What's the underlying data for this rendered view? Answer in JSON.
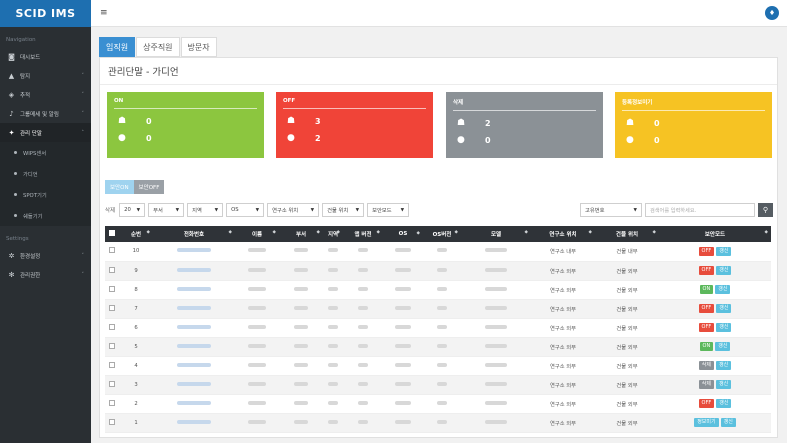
{
  "app": {
    "brand": "SCID IMS"
  },
  "colors": {
    "brand": "#1e6fb0",
    "on": "#8cc63f",
    "off": "#f04438",
    "delete": "#8b9196",
    "unreg": "#f6c323",
    "tab_active": "#3a8fd2",
    "toggle_on": "#9fd3ef",
    "toggle_off": "#9aa0a6",
    "badge_on": "#5cb85c",
    "badge_off": "#e74c3c",
    "badge_del": "#8b9196",
    "badge_unreg": "#5bc0de",
    "badge_info": "#5bc0de"
  },
  "sidebar": {
    "section1": "Navigation",
    "items": [
      {
        "label": "대시보드",
        "icon": "dashboard-icon",
        "glyph": "◙"
      },
      {
        "label": "탐지",
        "icon": "warning-icon",
        "glyph": "▲"
      },
      {
        "label": "추적",
        "icon": "tag-icon",
        "glyph": "◈"
      },
      {
        "label": "그룹메세 및 알림",
        "icon": "bell-icon",
        "glyph": "♪"
      },
      {
        "label": "관리 단말",
        "icon": "users-icon",
        "glyph": "✦"
      }
    ],
    "sub_items": [
      {
        "label": "WIPS센서"
      },
      {
        "label": "가디언"
      },
      {
        "label": "SPOT기기"
      },
      {
        "label": "쉐들기기"
      }
    ],
    "section2": "Settings",
    "settings_items": [
      {
        "label": "환경설정",
        "icon": "gears-icon",
        "glyph": "✲"
      },
      {
        "label": "관리권한",
        "icon": "gear-icon",
        "glyph": "✻"
      }
    ]
  },
  "topbar": {
    "menu_glyph": "≡",
    "bell_glyph": "♦"
  },
  "tabs": [
    {
      "label": "임직원"
    },
    {
      "label": "상주직원"
    },
    {
      "label": "방문자"
    }
  ],
  "panel": {
    "title": "관리단말 - 가디언"
  },
  "cards": [
    {
      "title": "ON",
      "android": "0",
      "apple": "0"
    },
    {
      "title": "OFF",
      "android": "3",
      "apple": "2"
    },
    {
      "title": "삭제",
      "android": "2",
      "apple": "0"
    },
    {
      "title": "등록정보미기",
      "android": "0",
      "apple": "0"
    }
  ],
  "card_glyphs": {
    "android": "☗",
    "apple": "●"
  },
  "toggle": {
    "on": "보안ON",
    "off": "보안OFF"
  },
  "filters": {
    "label": "삭제",
    "selects": [
      "20",
      "부서",
      "지역",
      "OS",
      "연구소 위치",
      "건물 위치",
      "보안모드"
    ],
    "search_select": "고유번호",
    "search_placeholder": "검색어를 입력하세요.",
    "search_glyph": "⚲"
  },
  "table": {
    "columns": [
      "순번",
      "전화번호",
      "이름",
      "부서",
      "지역",
      "앱 버전",
      "OS",
      "OS버전",
      "모델",
      "연구소 위치",
      "건물 위치",
      "보안모드"
    ],
    "rows": [
      {
        "no": "10",
        "lab": "연구소 내부",
        "bldg": "건물 내부",
        "mode": "OFF",
        "extra": "갱신"
      },
      {
        "no": "9",
        "lab": "연구소 외부",
        "bldg": "건물 외부",
        "mode": "OFF",
        "extra": "갱신"
      },
      {
        "no": "8",
        "lab": "연구소 외부",
        "bldg": "건물 외부",
        "mode": "ON",
        "extra": "갱신"
      },
      {
        "no": "7",
        "lab": "연구소 외부",
        "bldg": "건물 외부",
        "mode": "OFF",
        "extra": "갱신"
      },
      {
        "no": "6",
        "lab": "연구소 외부",
        "bldg": "건물 외부",
        "mode": "OFF",
        "extra": "갱신"
      },
      {
        "no": "5",
        "lab": "연구소 외부",
        "bldg": "건물 외부",
        "mode": "ON",
        "extra": "갱신"
      },
      {
        "no": "4",
        "lab": "연구소 외부",
        "bldg": "건물 외부",
        "mode": "삭제",
        "extra": "갱신"
      },
      {
        "no": "3",
        "lab": "연구소 외부",
        "bldg": "건물 외부",
        "mode": "삭제",
        "extra": "갱신"
      },
      {
        "no": "2",
        "lab": "연구소 외부",
        "bldg": "건물 외부",
        "mode": "OFF",
        "extra": "갱신"
      },
      {
        "no": "1",
        "lab": "연구소 외부",
        "bldg": "건물 외부",
        "mode": "정보미기",
        "extra": "갱신"
      }
    ]
  }
}
